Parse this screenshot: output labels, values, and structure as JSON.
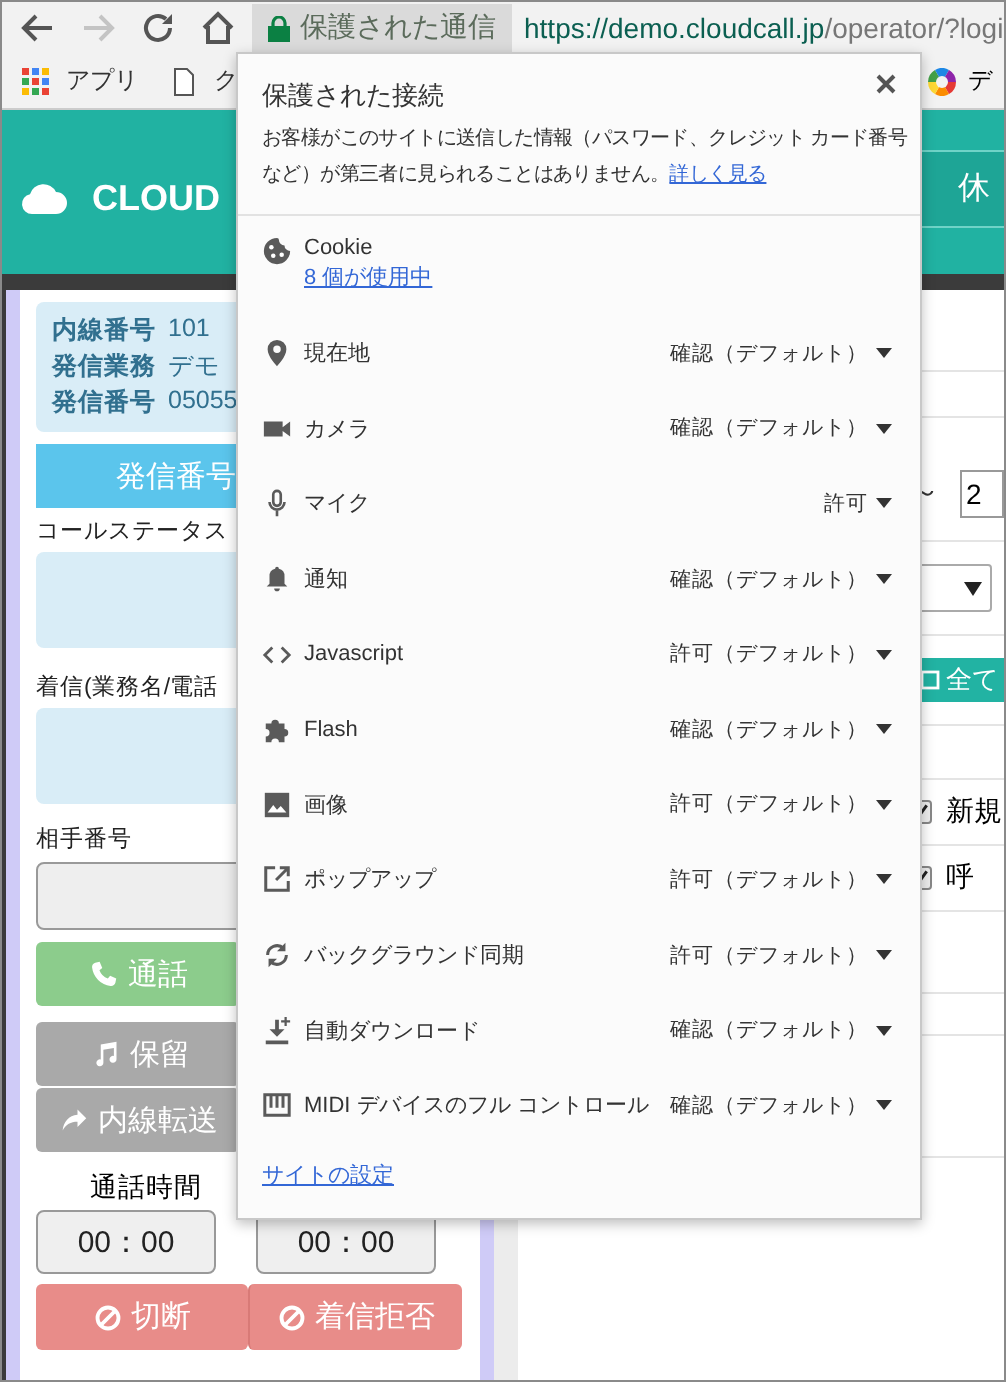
{
  "browser": {
    "security_chip": "保護された通信",
    "url_host": "https://demo.cloudcall.jp",
    "url_path": "/operator/?logi"
  },
  "bookmarks": [
    {
      "label": "アプリ",
      "kind": "apps"
    },
    {
      "label": "ク",
      "kind": "page"
    }
  ],
  "bookmarks_right": [
    {
      "label": "デ",
      "kind": "colorwheel"
    }
  ],
  "app_header": {
    "logo": "CLOUD",
    "break_button": "休"
  },
  "operator_panel": {
    "info": [
      {
        "label": "内線番号",
        "value": "101"
      },
      {
        "label": "発信業務",
        "value": "デモ"
      },
      {
        "label": "発信番号",
        "value": "05055"
      }
    ],
    "caller_id_button": "発信番号",
    "call_status_label": "コールステータス",
    "incoming_label": "着信(業務名/電話",
    "number_label": "相手番号",
    "actions": [
      {
        "label": "通話",
        "kind": "call",
        "disabled": false
      },
      {
        "label": "保留",
        "kind": "hold",
        "disabled": true
      },
      {
        "label": "内線転送",
        "kind": "transfer",
        "disabled": true
      }
    ],
    "talk_time_label": "通話時間",
    "timers": [
      "00：00",
      "00：00"
    ],
    "hangup_button": "切断",
    "reject_button": "着信拒否"
  },
  "right_panel": {
    "range_separator": "～",
    "range_end": "2",
    "all_button": "全て",
    "checkboxes": [
      {
        "label": "新規",
        "checked": true
      },
      {
        "label": "呼",
        "checked": true
      }
    ]
  },
  "site_info_popup": {
    "title": "保護された接続",
    "description": "お客様がこのサイトに送信した情報（パスワード、クレジット カード番号など）が第三者に見られることはありません。",
    "learn_more_link": "詳しく見る",
    "permissions": [
      {
        "name": "Cookie",
        "kind": "cookie",
        "detail": "8 個が使用中"
      },
      {
        "name": "現在地",
        "kind": "location",
        "setting": "確認（デフォルト）"
      },
      {
        "name": "カメラ",
        "kind": "camera",
        "setting": "確認（デフォルト）"
      },
      {
        "name": "マイク",
        "kind": "mic",
        "setting": "許可"
      },
      {
        "name": "通知",
        "kind": "bell",
        "setting": "確認（デフォルト）"
      },
      {
        "name": "Javascript",
        "kind": "code",
        "setting": "許可（デフォルト）"
      },
      {
        "name": "Flash",
        "kind": "puzzle",
        "setting": "確認（デフォルト）"
      },
      {
        "name": "画像",
        "kind": "image",
        "setting": "許可（デフォルト）"
      },
      {
        "name": "ポップアップ",
        "kind": "popup",
        "setting": "許可（デフォルト）"
      },
      {
        "name": "バックグラウンド同期",
        "kind": "sync",
        "setting": "許可（デフォルト）"
      },
      {
        "name": "自動ダウンロード",
        "kind": "download",
        "setting": "確認（デフォルト）"
      },
      {
        "name": "MIDI デバイスのフル コントロール",
        "kind": "midi",
        "setting": "確認（デフォルト）"
      }
    ],
    "site_settings_link": "サイトの設定"
  }
}
